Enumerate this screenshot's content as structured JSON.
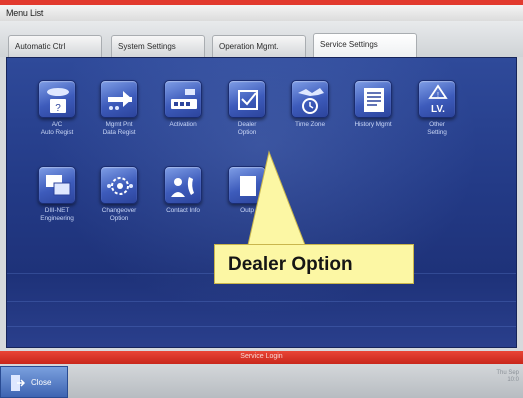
{
  "window": {
    "title": "Menu List"
  },
  "tabs": [
    {
      "label": "Automatic Ctrl"
    },
    {
      "label": "System Settings"
    },
    {
      "label": "Operation Mgmt."
    },
    {
      "label": "Service Settings"
    }
  ],
  "tiles": [
    {
      "label_line1": "A/C",
      "label_line2": "Auto Regist",
      "icon": "ac-auto-regist-icon"
    },
    {
      "label_line1": "Mgmt Pnt",
      "label_line2": "Data Regist",
      "icon": "mgmt-data-regist-icon"
    },
    {
      "label_line1": "Activation",
      "label_line2": "",
      "icon": "activation-icon"
    },
    {
      "label_line1": "Dealer",
      "label_line2": "Option",
      "icon": "dealer-option-icon"
    },
    {
      "label_line1": "Time Zone",
      "label_line2": "",
      "icon": "time-zone-icon"
    },
    {
      "label_line1": "History Mgmt",
      "label_line2": "",
      "icon": "history-mgmt-icon"
    },
    {
      "label_line1": "Other",
      "label_line2": "Setting",
      "icon": "other-setting-icon"
    },
    {
      "label_line1": "DIII-NET",
      "label_line2": "Engineering",
      "icon": "diii-net-icon"
    },
    {
      "label_line1": "Changeover",
      "label_line2": "Option",
      "icon": "changeover-icon"
    },
    {
      "label_line1": "Contact Info",
      "label_line2": "",
      "icon": "contact-info-icon"
    },
    {
      "label_line1": "Outp",
      "label_line2": "",
      "icon": "output-icon"
    }
  ],
  "callout": {
    "text": "Dealer Option"
  },
  "status": {
    "text": "Service Login"
  },
  "bottom": {
    "close_label": "Close",
    "corner_line1": "Thu Sep",
    "corner_line2": "10:0"
  }
}
